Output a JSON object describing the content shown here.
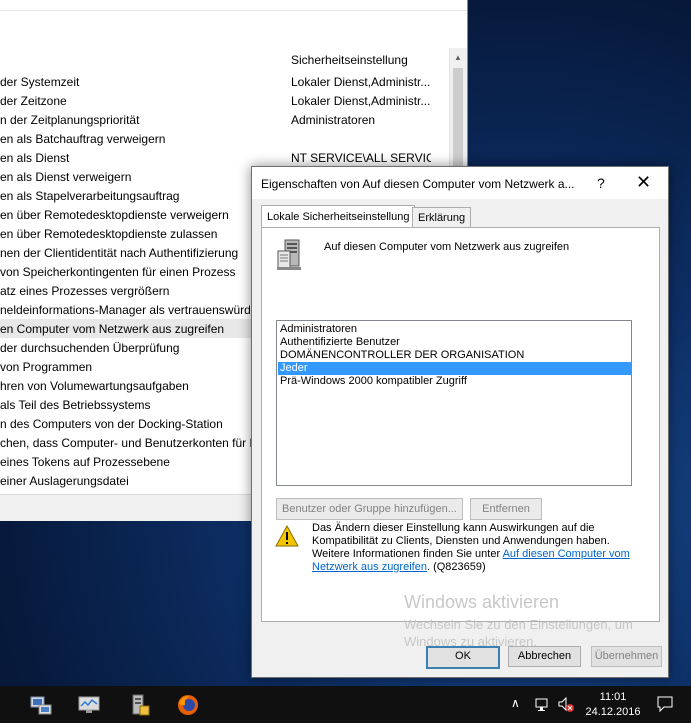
{
  "background_window": {
    "column_header": "Sicherheitseinstellung",
    "rows": [
      {
        "policy": "der Systemzeit",
        "setting": "Lokaler Dienst,Administr..."
      },
      {
        "policy": "der Zeitzone",
        "setting": "Lokaler Dienst,Administr..."
      },
      {
        "policy": "n der Zeitplanungspriorität",
        "setting": "Administratoren"
      },
      {
        "policy": "en als Batchauftrag verweigern",
        "setting": ""
      },
      {
        "policy": "en als Dienst",
        "setting": "NT SERVICE\\ALL SERVIC..."
      },
      {
        "policy": "en als Dienst verweigern",
        "setting": ""
      },
      {
        "policy": "en als Stapelverarbeitungsauftrag",
        "setting": ""
      },
      {
        "policy": "en über Remotedesktopdienste verweigern",
        "setting": ""
      },
      {
        "policy": "en über Remotedesktopdienste zulassen",
        "setting": ""
      },
      {
        "policy": "nen der Clientidentität nach Authentifizierung",
        "setting": ""
      },
      {
        "policy": "von Speicherkontingenten für einen Prozess",
        "setting": ""
      },
      {
        "policy": "atz eines Prozesses vergrößern",
        "setting": ""
      },
      {
        "policy": "neldeinformations-Manager als vertrauenswürdi",
        "setting": ""
      },
      {
        "policy": "en Computer vom Netzwerk aus zugreifen",
        "setting": ""
      },
      {
        "policy": "der durchsuchenden Überprüfung",
        "setting": ""
      },
      {
        "policy": "von Programmen",
        "setting": ""
      },
      {
        "policy": "hren von Volumewartungsaufgaben",
        "setting": ""
      },
      {
        "policy": "als Teil des Betriebssystems",
        "setting": ""
      },
      {
        "policy": "n des Computers von der Docking-Station",
        "setting": ""
      },
      {
        "policy": "chen, dass Computer- und Benutzerkonten für D",
        "setting": ""
      },
      {
        "policy": "eines Tokens auf Prozessebene",
        "setting": ""
      },
      {
        "policy": "einer Auslagerungsdatei",
        "setting": ""
      }
    ],
    "selected_row_index": 13
  },
  "dialog": {
    "title": "Eigenschaften von Auf diesen Computer vom Netzwerk a...",
    "help_glyph": "?",
    "close_glyph": "✕",
    "tabs": [
      {
        "label": "Lokale Sicherheitseinstellung",
        "active": true
      },
      {
        "label": "Erklärung",
        "active": false
      }
    ],
    "policy_heading": "Auf diesen Computer vom Netzwerk aus zugreifen",
    "list_items": [
      "Administratoren",
      "Authentifizierte Benutzer",
      "DOMÄNENCONTROLLER DER ORGANISATION",
      "Jeder",
      "Prä-Windows 2000 kompatibler Zugriff"
    ],
    "selected_item_index": 3,
    "add_button": "Benutzer oder Gruppe hinzufügen...",
    "remove_button": "Entfernen",
    "note_line1": "Das Ändern dieser Einstellung kann Auswirkungen auf die",
    "note_line2": "Kompatibilität zu Clients, Diensten und Anwendungen haben.",
    "note_line3_prefix": "Weitere Informationen finden Sie unter ",
    "note_link": "Auf diesen Computer vom Netzwerk aus zugreifen",
    "note_suffix": ". (Q823659)",
    "ok_button": "OK",
    "cancel_button": "Abbrechen",
    "apply_button": "Übernehmen"
  },
  "watermark": {
    "line1": "Windows aktivieren",
    "line2": "Wechseln Sie zu den Einstellungen, um",
    "line3": "Windows zu aktivieren."
  },
  "taskbar": {
    "time": "11:01",
    "date": "24.12.2016",
    "tray_chevron": "∧"
  },
  "colors": {
    "selection": "#3399ff",
    "link": "#0066cc",
    "desktop": "#0d2f66"
  }
}
